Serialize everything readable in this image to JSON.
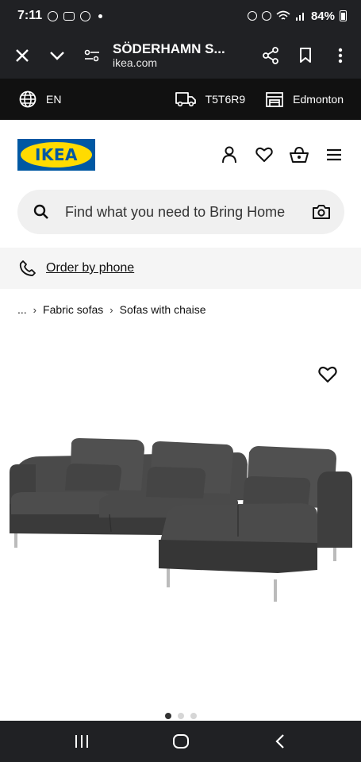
{
  "status": {
    "time": "7:11",
    "battery": "84%"
  },
  "browser": {
    "title": "SÖDERHAMN S...",
    "url": "ikea.com",
    "icons": [
      "close-icon",
      "chevron-down-icon",
      "tune-icon",
      "share-icon",
      "bookmark-icon",
      "more-vert-icon"
    ]
  },
  "utility": {
    "language": "EN",
    "postal_code": "T5T6R9",
    "store": "Edmonton"
  },
  "header": {
    "logo_text": "IKEA",
    "icons": [
      "user-icon",
      "heart-icon",
      "basket-icon",
      "menu-icon"
    ]
  },
  "search": {
    "placeholder": "Find what you need to Bring Home"
  },
  "order": {
    "label": "Order by phone"
  },
  "breadcrumb": {
    "items": [
      "...",
      "Fabric sofas",
      "Sofas with chaise"
    ]
  },
  "carousel": {
    "count": 3,
    "active_index": 0
  },
  "colors": {
    "ikea_blue": "#0058a3",
    "ikea_yellow": "#ffdb00",
    "sofa": "#3d3d3d"
  }
}
